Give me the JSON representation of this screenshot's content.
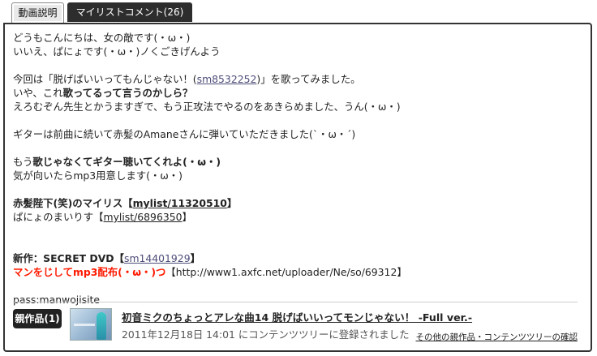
{
  "tabs": {
    "description": "動画説明",
    "mylist_comments": "マイリストコメント(26)"
  },
  "description": {
    "l1": "どうもこんにちは、女の敵です(・ω・)",
    "l2": "いいえ、ぱにょです(・ω・)ノくごきげんよう",
    "l4_pre": "今回は「脱げばいいってもんじゃない！(",
    "l4_link": "sm8532252",
    "l4_post": ")」を歌ってみました。",
    "l5_pre": "いや、これ",
    "l5_bold": "歌ってるって言うのかしら？",
    "l6": "えろむぞん先生とかうますぎで、もう正攻法でやるのをあきらめました、うん(・ω・)",
    "l8": "ギターは前曲に続いて赤髪のAmaneさんに弾いていただきました(`・ω・´)",
    "l10_pre": "もう",
    "l10_bold": "歌じゃなくてギター聴いてくれよ(・ω・)",
    "l11": "気が向いたらmp3用意します(・ω・)",
    "l13_pre": "赤髪陛下(笑)のマイリス【",
    "l13_link": "mylist/11320510",
    "l13_post": "】",
    "l14_pre": "ぱにょのまいりす【",
    "l14_link": "mylist/6896350",
    "l14_post": "】",
    "l17_pre": "新作：SECRET DVD【",
    "l17_link": "sm14401929",
    "l17_post": "】",
    "l18_red": "マンをじしてmp3配布(・ω・)つ",
    "l18_rest": "【http://www1.axfc.net/uploader/Ne/so/69312】",
    "l20": "pass:manwojisite"
  },
  "parent_work": {
    "badge": "親作品(1)",
    "title": "初音ミクのちょっとアレな曲14 脱げばいいってモンじゃない！ -Full ver.-",
    "date": "2011年12月18日 14:01 にコンテンツツリーに登録されました",
    "more_link": "その他の親作品・コンテンツツリーの確認"
  }
}
